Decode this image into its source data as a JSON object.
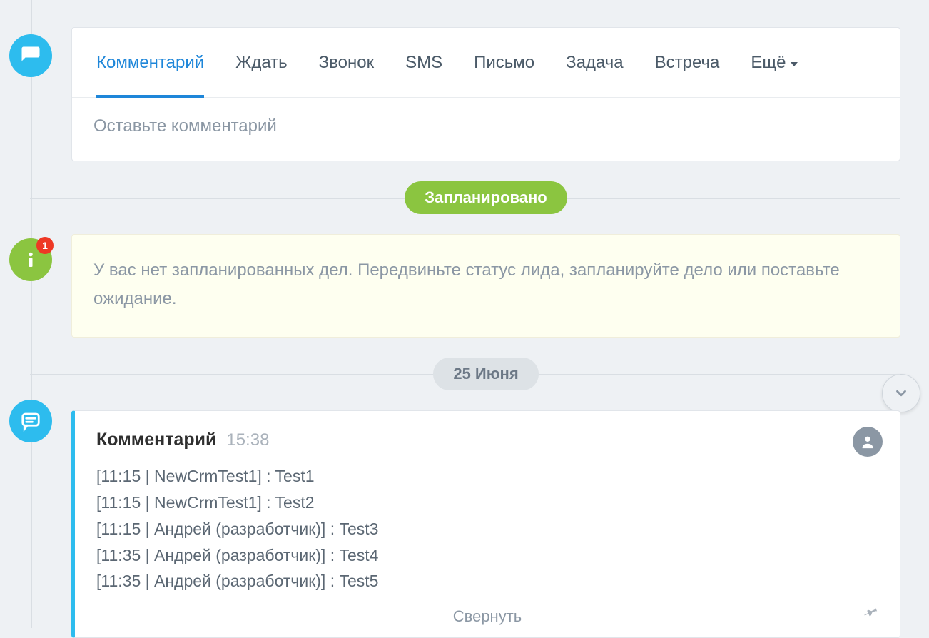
{
  "tabs": {
    "comment": "Комментарий",
    "wait": "Ждать",
    "call": "Звонок",
    "sms": "SMS",
    "email": "Письмо",
    "task": "Задача",
    "meeting": "Встреча",
    "more": "Ещё"
  },
  "comment_input_placeholder": "Оставьте комментарий",
  "planned_pill": "Запланировано",
  "info_badge_count": "1",
  "info_message": "У вас нет запланированных дел. Передвиньте статус лида, запланируйте дело или поставьте ожидание.",
  "date_pill": "25 Июня",
  "entry": {
    "title": "Комментарий",
    "time": "15:38",
    "lines": [
      "[11:15 | NewCrmTest1] : Test1",
      "[11:15 | NewCrmTest1] : Test2",
      "[11:15 | Андрей (разработчик)] : Test3",
      "[11:35 | Андрей (разработчик)] : Test4",
      "[11:35 | Андрей (разработчик)] : Test5"
    ],
    "collapse": "Свернуть"
  }
}
